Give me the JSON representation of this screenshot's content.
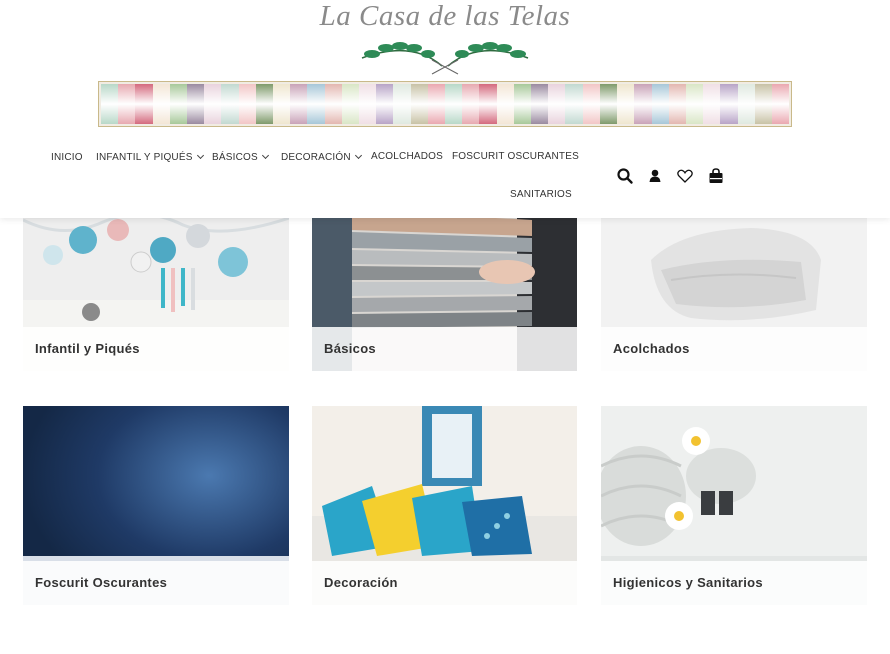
{
  "site": {
    "logo_text": "La Casa de las Telas",
    "brand_colors": {
      "leaf": "#2e8b57",
      "title": "#8a8a8a",
      "frame": "#c9b98a"
    }
  },
  "fabric_swatches": [
    "#b8d8c8",
    "#e7a9b0",
    "#d46a7e",
    "#f3e6d6",
    "#a8c99a",
    "#9a8aa0",
    "#e9d3dd",
    "#c2d9d1",
    "#f2c6c6",
    "#7f9a6b",
    "#efe6cf",
    "#c9a3b8",
    "#a7c7d8",
    "#e3b7b0",
    "#d9e6c6",
    "#f0dfe5",
    "#b8a4c7",
    "#dfe9e0",
    "#c8c2a6",
    "#eaa8b0"
  ],
  "nav": {
    "items": [
      {
        "label": "INICIO",
        "has_dropdown": false
      },
      {
        "label": "INFANTIL Y PIQUÉS",
        "has_dropdown": true
      },
      {
        "label": "BÁSICOS",
        "has_dropdown": true
      },
      {
        "label": "DECORACIÓN",
        "has_dropdown": true
      },
      {
        "label": "ACOLCHADOS",
        "has_dropdown": false
      },
      {
        "label": "FOSCURIT OSCURANTES",
        "has_dropdown": false
      },
      {
        "label": "SANITARIOS",
        "has_dropdown": false
      }
    ],
    "icons": [
      "search-icon",
      "user-icon",
      "heart-icon",
      "shopping-bag-icon"
    ]
  },
  "categories": [
    {
      "label": "Infantil y Piqués"
    },
    {
      "label": "Básicos"
    },
    {
      "label": "Acolchados"
    },
    {
      "label": "Foscurit Oscurantes"
    },
    {
      "label": "Decoración"
    },
    {
      "label": "Higienicos y Sanitarios"
    }
  ]
}
